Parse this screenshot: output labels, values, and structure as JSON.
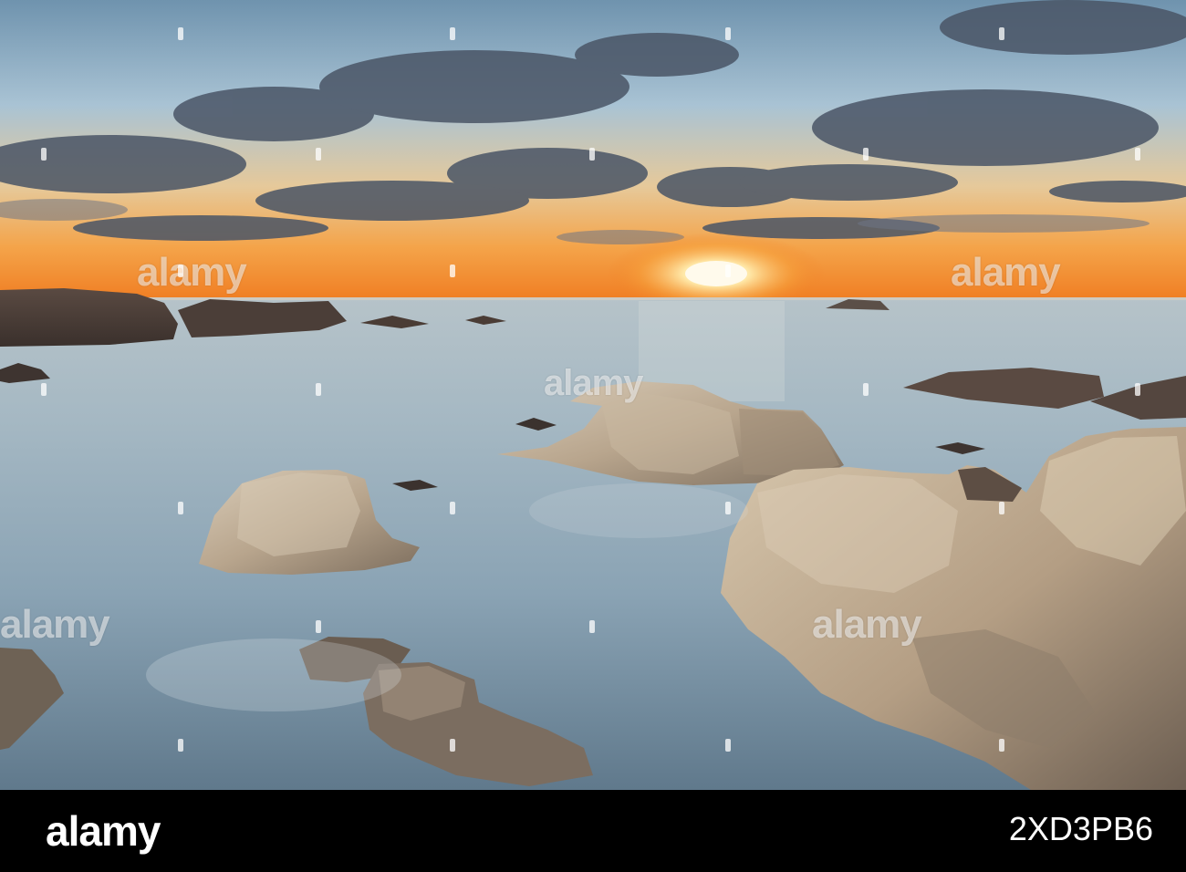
{
  "image": {
    "subject": "seascape-sunset",
    "colors": {
      "sky_top": "#7fa7c4",
      "sunset_orange": "#f08a24",
      "sun": "#fff6d6",
      "water": "#8fa9b8",
      "rock": "#b8a48c",
      "footer_bg": "#000000"
    }
  },
  "watermark": {
    "text": "alamy",
    "stock_id": "2XD3PB6"
  }
}
